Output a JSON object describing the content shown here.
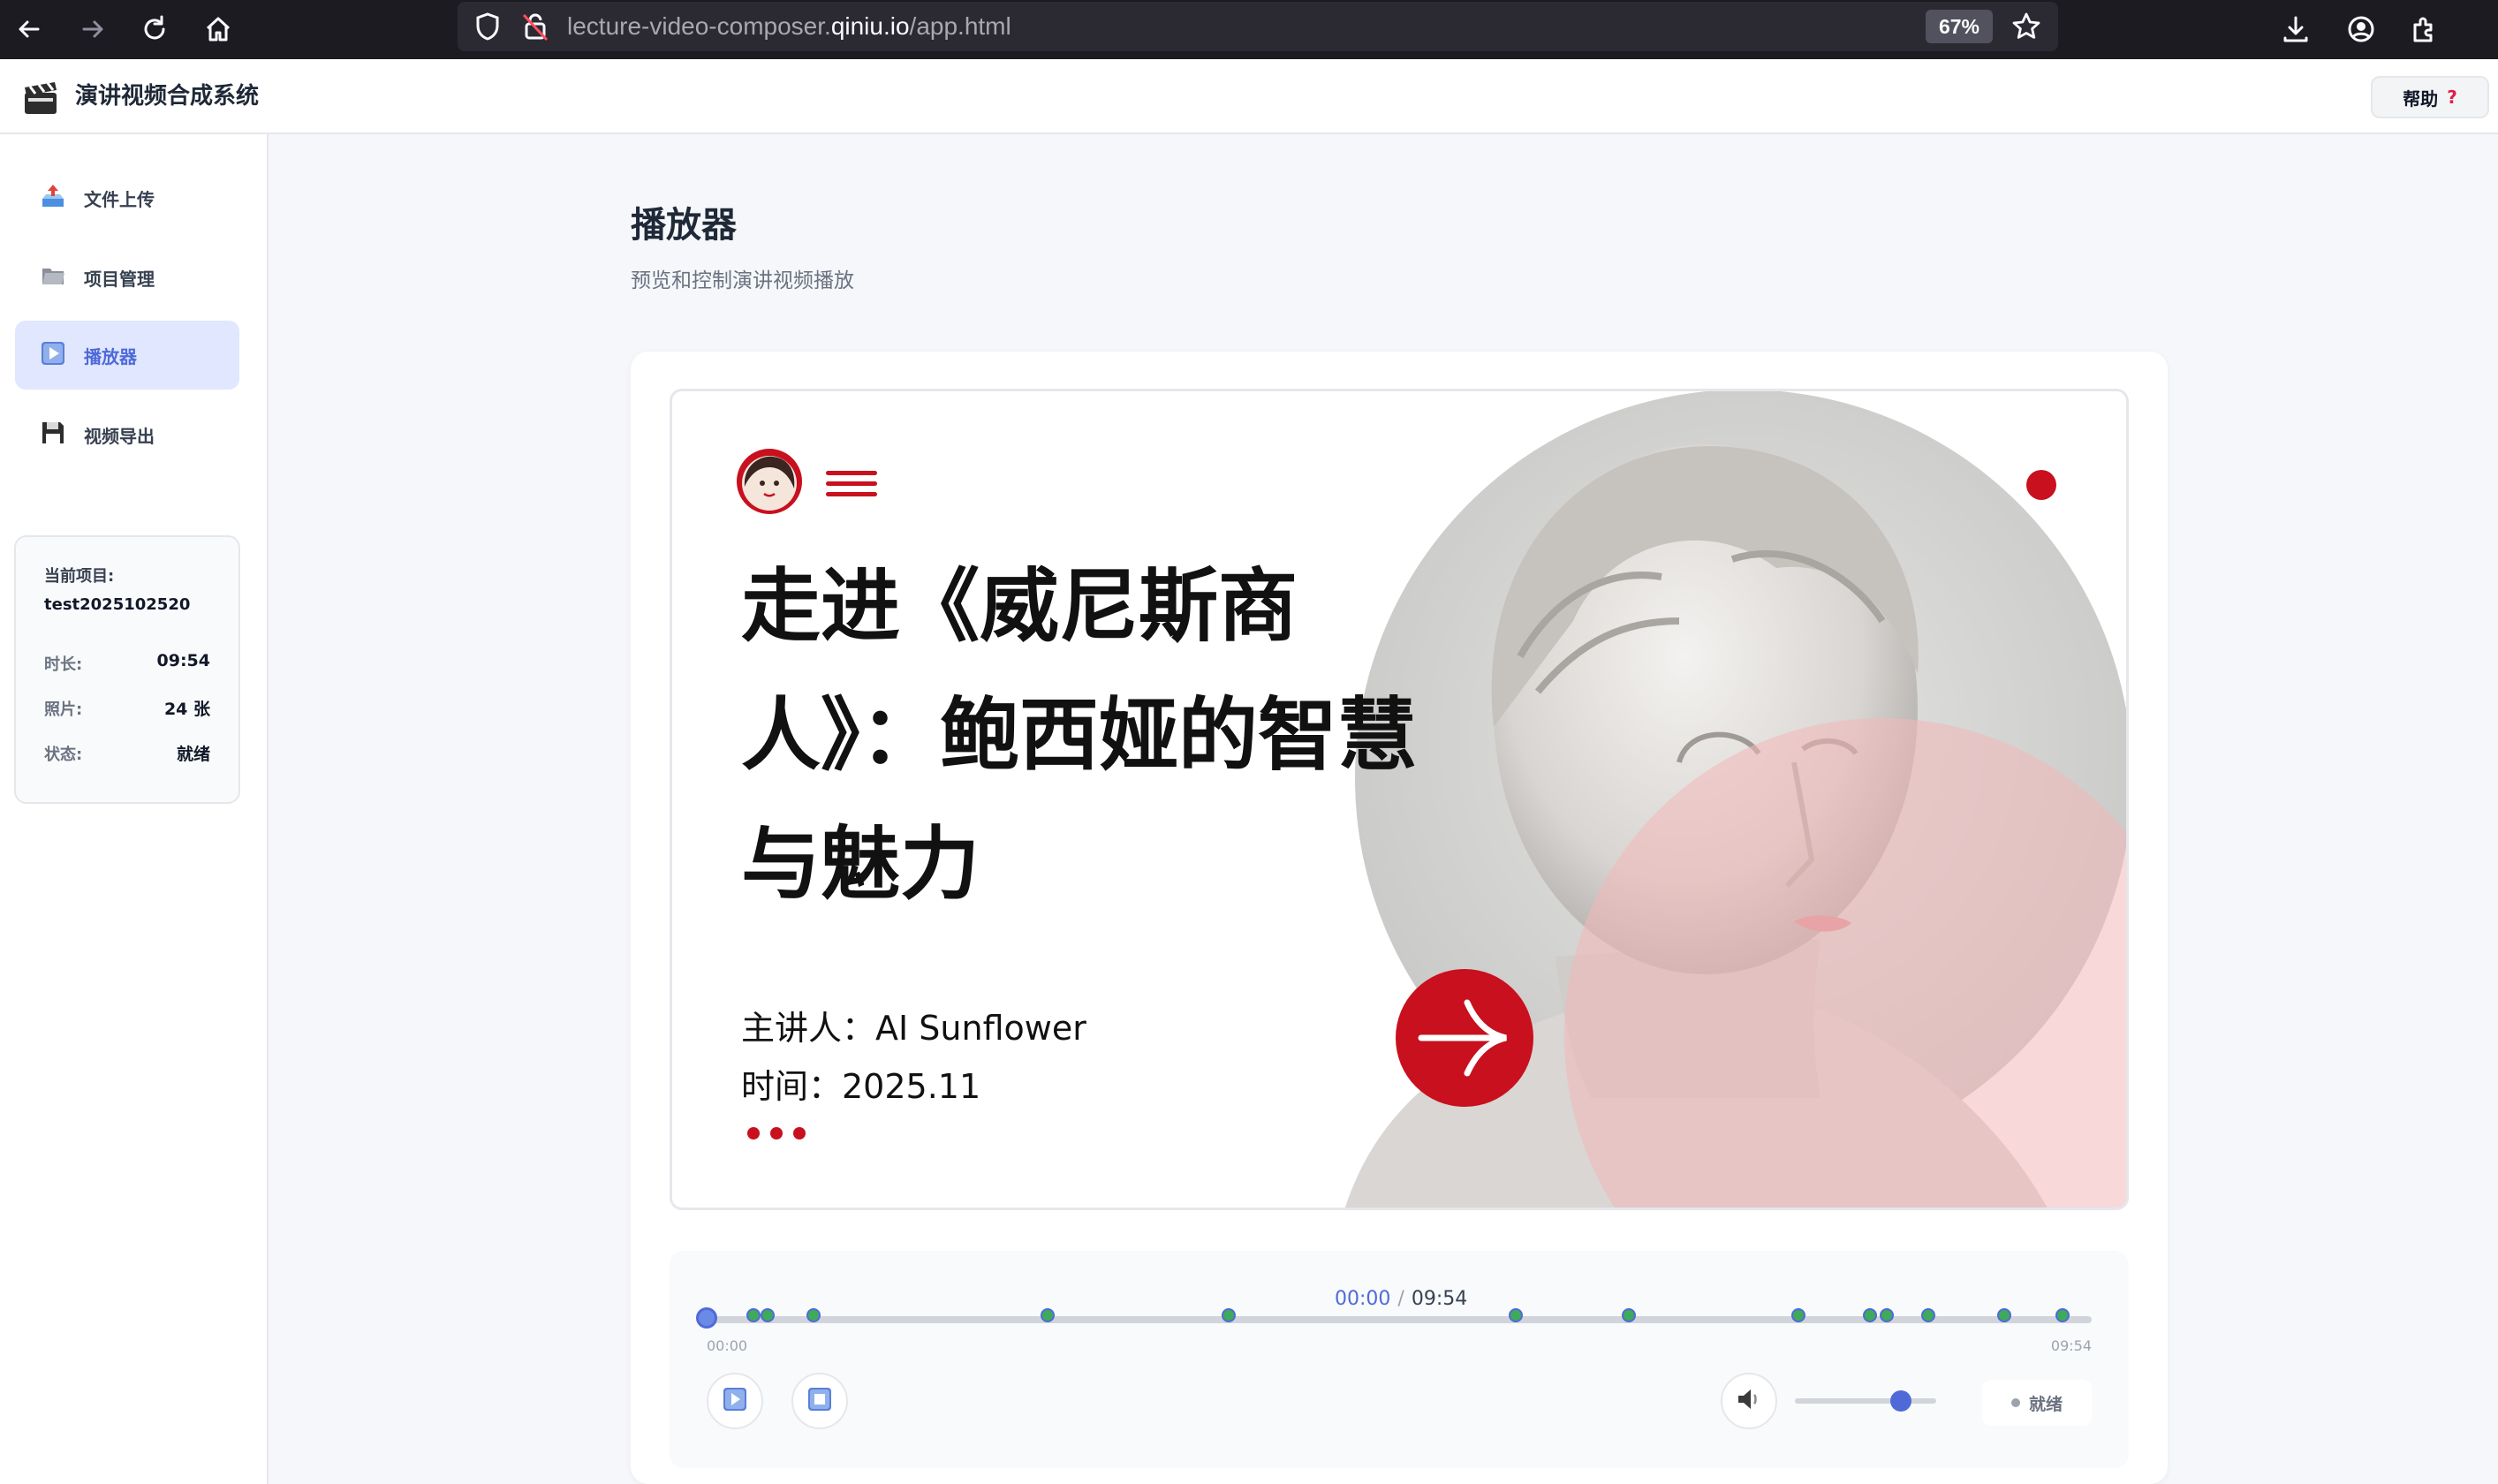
{
  "browser": {
    "url_prefix": "lecture-video-composer.",
    "url_domain": "qiniu.io",
    "url_path": "/app.html",
    "zoom": "67%"
  },
  "header": {
    "title": "演讲视频合成系统",
    "help_label": "帮助",
    "help_mark": "?"
  },
  "sidebar": {
    "items": [
      {
        "label": "文件上传",
        "icon": "upload-icon"
      },
      {
        "label": "项目管理",
        "icon": "folder-icon"
      },
      {
        "label": "播放器",
        "icon": "play-icon",
        "active": true
      },
      {
        "label": "视频导出",
        "icon": "save-icon"
      }
    ],
    "project": {
      "heading": "当前项目:",
      "name": "test2025102520",
      "duration_label": "时长:",
      "duration": "09:54",
      "photos_label": "照片:",
      "photos": "24 张",
      "status_label": "状态:",
      "status": "就绪"
    }
  },
  "main": {
    "title": "播放器",
    "subtitle": "预览和控制演讲视频播放"
  },
  "slide": {
    "title": "走进《威尼斯商人》：鲍西娅的智慧与魅力",
    "speaker": "主讲人：AI Sunflower",
    "date": "时间：2025.11",
    "accent_color": "#c8101e"
  },
  "player": {
    "current_time": "00:00",
    "separator": "/",
    "total_time": "09:54",
    "start_label": "00:00",
    "end_label": "09:54",
    "progress": 0,
    "volume": 0.75,
    "status": "就绪",
    "photo_markers_fraction": [
      0.034,
      0.044,
      0.077,
      0.246,
      0.377,
      0.584,
      0.666,
      0.788,
      0.84,
      0.852,
      0.882,
      0.937,
      0.979
    ]
  }
}
